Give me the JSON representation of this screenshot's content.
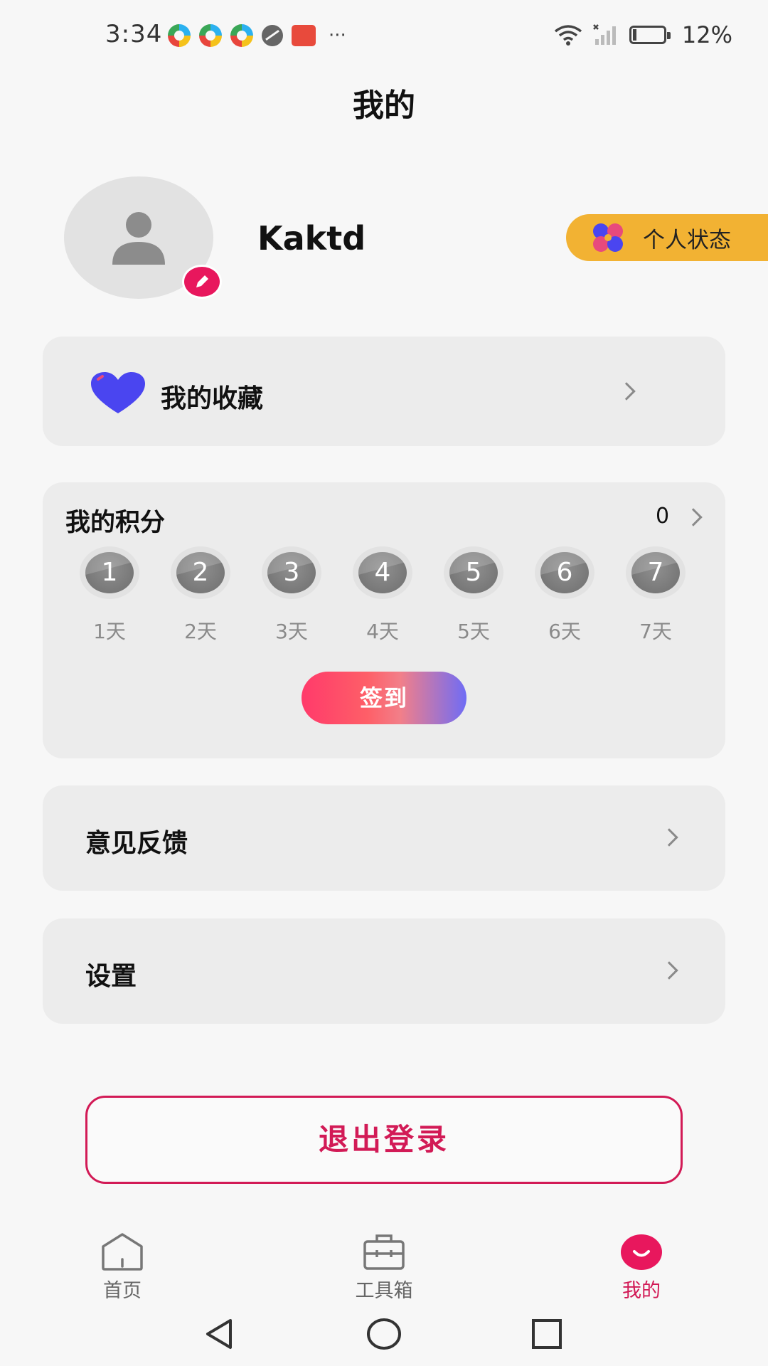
{
  "status_bar": {
    "time": "3:34",
    "battery_level": "12%",
    "battery_fraction": 0.12,
    "icons": [
      "swirl-app-icon",
      "swirl-app-icon",
      "swirl-app-icon",
      "globe-icon",
      "huawei-app-icon",
      "more-notifications-icon",
      "wifi-icon",
      "signal-icon",
      "battery-icon"
    ]
  },
  "header": {
    "title": "我的"
  },
  "profile": {
    "username": "Kaktd",
    "status_button": "个人状态"
  },
  "favorites": {
    "label": "我的收藏"
  },
  "points": {
    "title": "我的积分",
    "value": "0",
    "days": [
      {
        "num": "1",
        "label": "1天"
      },
      {
        "num": "2",
        "label": "2天"
      },
      {
        "num": "3",
        "label": "3天"
      },
      {
        "num": "4",
        "label": "4天"
      },
      {
        "num": "5",
        "label": "5天"
      },
      {
        "num": "6",
        "label": "6天"
      },
      {
        "num": "7",
        "label": "7天"
      }
    ],
    "signin_label": "签到"
  },
  "menu": {
    "feedback": "意见反馈",
    "settings": "设置"
  },
  "logout": {
    "label": "退出登录"
  },
  "tabs": [
    {
      "label": "首页",
      "icon": "home-icon",
      "active": false
    },
    {
      "label": "工具箱",
      "icon": "toolbox-icon",
      "active": false
    },
    {
      "label": "我的",
      "icon": "smile-icon",
      "active": true
    }
  ],
  "colors": {
    "accent": "#d21a56",
    "status_pill": "#f2b233",
    "card_bg": "#ececec",
    "heart": "#4a45f0"
  }
}
